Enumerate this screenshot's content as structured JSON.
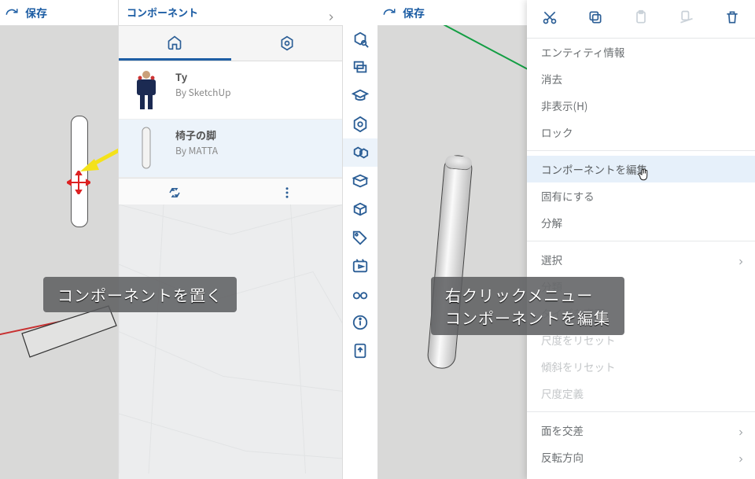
{
  "left": {
    "save_label": "保存",
    "panel_title": "コンポーネント",
    "tabs": {
      "home_icon": "home-icon",
      "hex_icon": "hex-settings-icon"
    },
    "items": [
      {
        "name": "Ty",
        "by": "By SketchUp"
      },
      {
        "name": "椅子の脚",
        "by": "By MATTA"
      }
    ],
    "caption": "コンポーネントを置く"
  },
  "tray_icons": [
    "search-component-icon",
    "layers-icon",
    "graduation-icon",
    "component-settings-icon",
    "components-3d-icon",
    "surface-icon",
    "box-icon",
    "tag-icon",
    "video-icon",
    "glasses-icon",
    "info-icon",
    "export-icon"
  ],
  "right": {
    "save_label": "保存",
    "caption_line1": "右クリックメニュー",
    "caption_line2": "コンポーネントを編集",
    "menu": {
      "toolbar": [
        "cut-icon",
        "copy-icon",
        "paste-icon",
        "paste-surface-icon",
        "delete-icon"
      ],
      "group1": [
        "エンティティ情報",
        "消去",
        "非表示(H)",
        "ロック"
      ],
      "group2": [
        "コンポーネントを編集",
        "固有にする",
        "分解"
      ],
      "group3_parent": "選択",
      "group3_disabled": [
        "分類",
        "タイプを変更",
        "尺度をリセット",
        "傾斜をリセット",
        "尺度定義"
      ],
      "group4": [
        "面を交差",
        "反転方向"
      ]
    }
  }
}
